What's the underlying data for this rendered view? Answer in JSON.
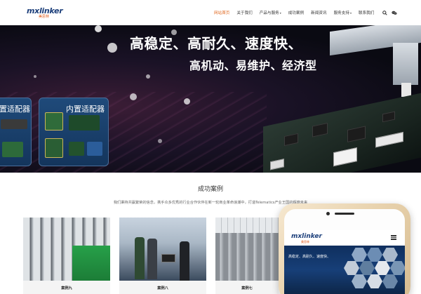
{
  "header": {
    "logo_text": "mxlinker",
    "logo_sub": "美思林",
    "nav": [
      {
        "label": "网站首页",
        "active": true,
        "dropdown": false
      },
      {
        "label": "关于我们",
        "active": false,
        "dropdown": false
      },
      {
        "label": "产品与服务",
        "active": false,
        "dropdown": true
      },
      {
        "label": "成功案例",
        "active": false,
        "dropdown": false
      },
      {
        "label": "新闻资讯",
        "active": false,
        "dropdown": false
      },
      {
        "label": "服务支持",
        "active": false,
        "dropdown": true
      },
      {
        "label": "联系我们",
        "active": false,
        "dropdown": false
      }
    ],
    "icons": [
      "search-icon",
      "wechat-icon"
    ],
    "accent_color": "#e0681f"
  },
  "hero": {
    "line1": "高稳定、高耐久、速度快、",
    "line2": "高机动、易维护、经济型",
    "card_left_title": "置适配器",
    "card_right_title": "内置适配器"
  },
  "cases": {
    "title": "成功案例",
    "description": "我们秉持共赢繁荣的信念，携手众多优秀的行业合作伙伴在新一轮商业革命浪潮中，打造Telematics产业王国的辉煌未来",
    "items": [
      {
        "label": "案例九"
      },
      {
        "label": "案例八"
      },
      {
        "label": "案例七"
      }
    ]
  },
  "phone": {
    "logo_text": "mxlinker",
    "logo_sub": "美思林",
    "hero_text": "高稳定、高耐久、速度快、",
    "menu_icon": "menu-icon"
  }
}
